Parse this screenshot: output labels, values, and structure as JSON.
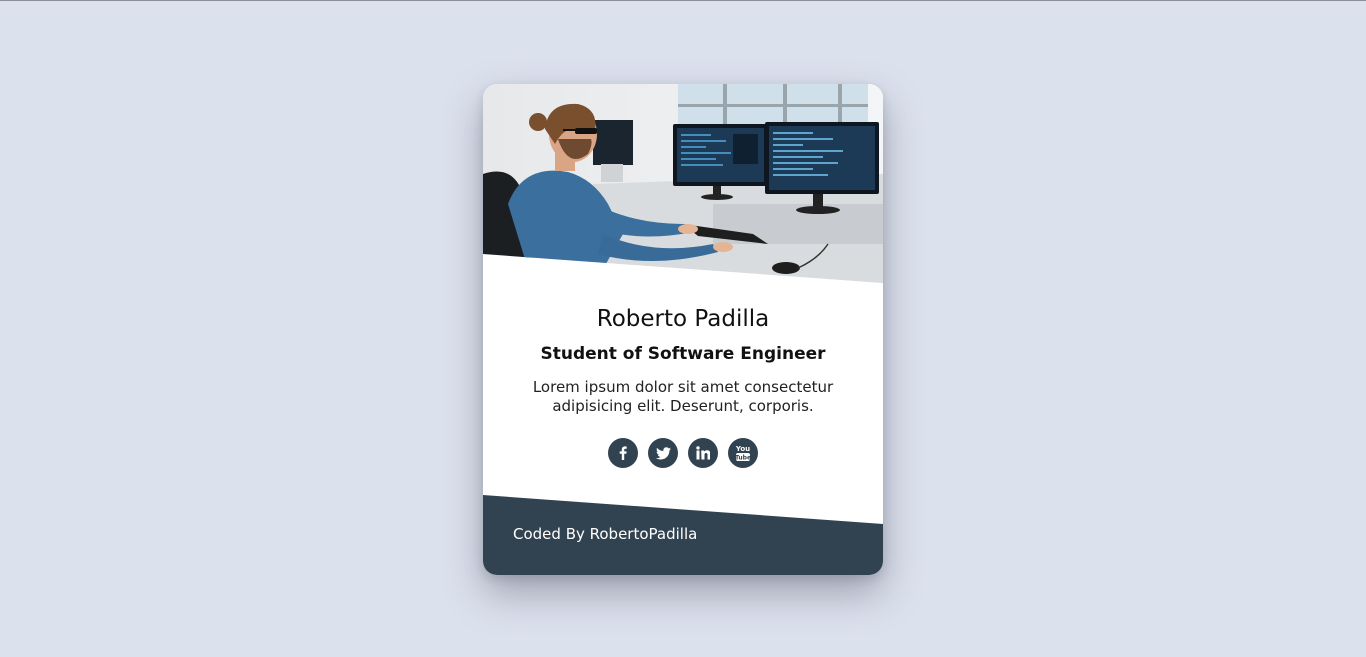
{
  "profile": {
    "name": "Roberto Padilla",
    "role": "Student of Software Engineer",
    "description": "Lorem ipsum dolor sit amet consectetur adipisicing elit. Deserunt, corporis."
  },
  "socials": [
    {
      "icon": "facebook-icon",
      "glyph": "f"
    },
    {
      "icon": "twitter-icon",
      "glyph": "t"
    },
    {
      "icon": "linkedin-icon",
      "glyph": "in"
    },
    {
      "icon": "youtube-icon",
      "glyph": "You Tube"
    }
  ],
  "footer": {
    "text": "Coded By RobertoPadilla"
  },
  "colors": {
    "background": "#dce1ee",
    "card": "#ffffff",
    "accent": "#314350"
  }
}
